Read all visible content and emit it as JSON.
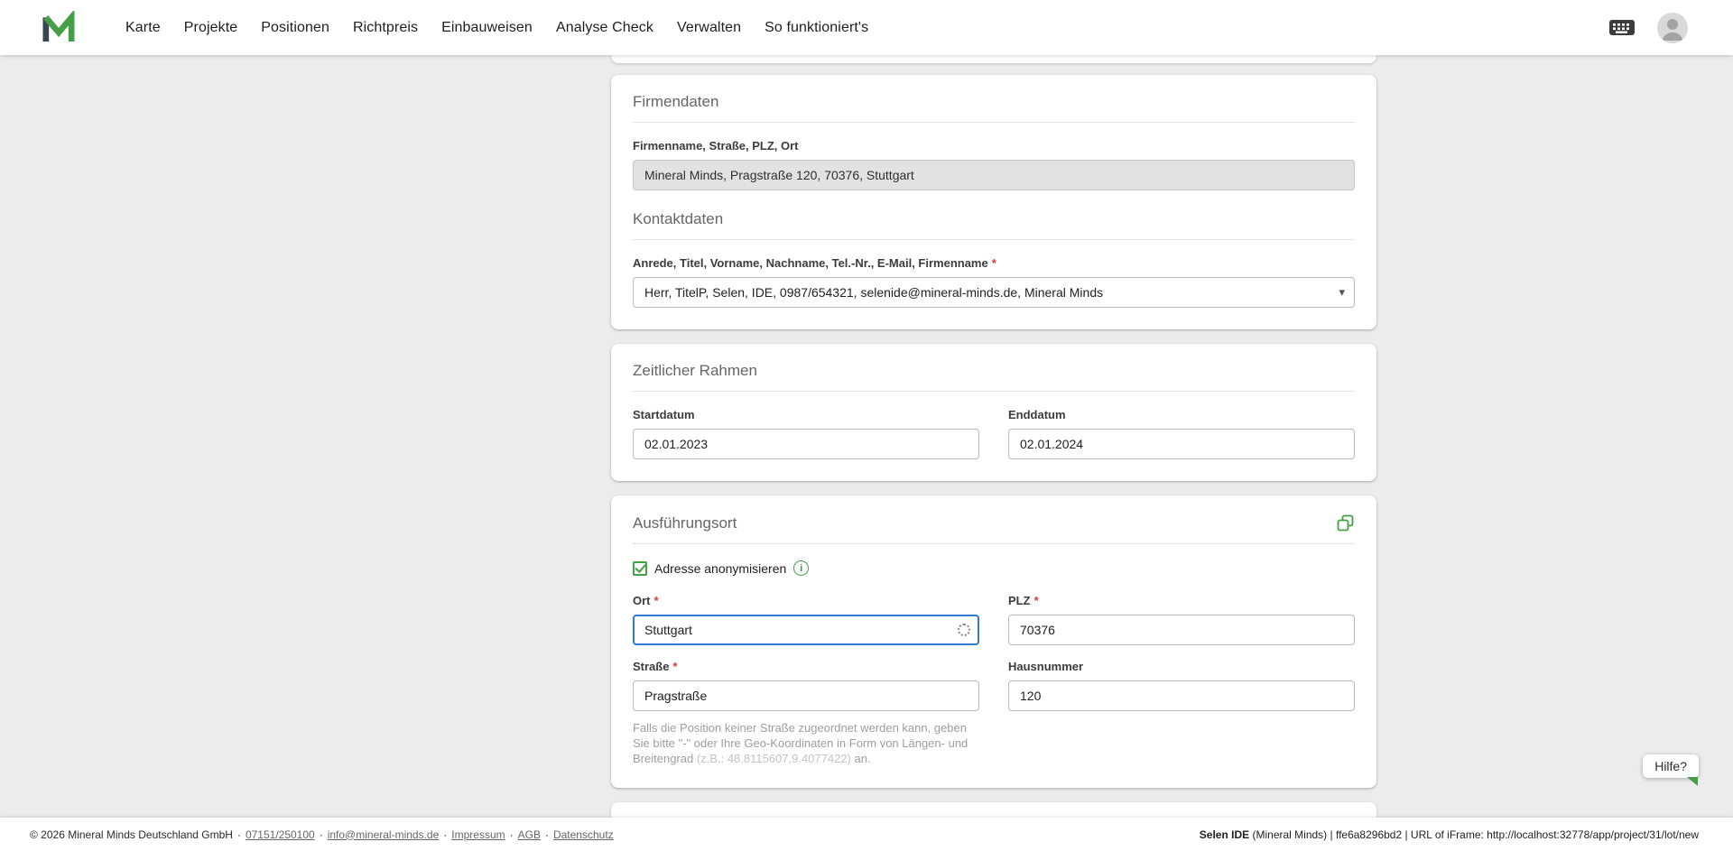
{
  "nav": {
    "items": [
      "Karte",
      "Projekte",
      "Positionen",
      "Richtpreis",
      "Einbauweisen",
      "Analyse Check",
      "Verwalten",
      "So funktioniert's"
    ]
  },
  "misc": {
    "required_marker": "*",
    "caret": "▾",
    "info_glyph": "i",
    "separator": "·"
  },
  "colors": {
    "brand_green": "#43a047",
    "focus_blue": "#2e7cd6",
    "required_red": "#e53935"
  },
  "cards": {
    "firmendaten": {
      "title": "Firmendaten",
      "company_label": "Firmenname, Straße, PLZ, Ort",
      "company_value": "Mineral Minds, Pragstraße 120, 70376, Stuttgart",
      "kontakt_title": "Kontaktdaten",
      "kontakt_label": "Anrede, Titel, Vorname, Nachname, Tel.-Nr., E-Mail, Firmenname",
      "kontakt_value": "Herr, TitelP, Selen, IDE, 0987/654321, selenide@mineral-minds.de, Mineral Minds"
    },
    "zeitraum": {
      "title": "Zeitlicher Rahmen",
      "start_label": "Startdatum",
      "start_value": "02.01.2023",
      "end_label": "Enddatum",
      "end_value": "02.01.2024"
    },
    "ausfuehrungsort": {
      "title": "Ausführungsort",
      "anonymize_label": "Adresse anonymisieren",
      "ort_label": "Ort",
      "ort_value": "Stuttgart",
      "plz_label": "PLZ",
      "plz_value": "70376",
      "strasse_label": "Straße",
      "strasse_value": "Pragstraße",
      "hausnummer_label": "Hausnummer",
      "hausnummer_value": "120",
      "helper_text": "Falls die Position keiner Straße zugeordnet werden kann, geben Sie bitte \"-\" oder Ihre Geo-Koordinaten in Form von Längen- und Breitengrad ",
      "helper_example": "(z.B.: 48.8115607,9.4077422)",
      "helper_suffix": " an."
    }
  },
  "help_button": {
    "label": "Hilfe?"
  },
  "footer": {
    "copyright": "© 2026 Mineral Minds Deutschland GmbH",
    "links": [
      "07151/250100",
      "info@mineral-minds.de",
      "Impressum",
      "AGB",
      "Datenschutz"
    ],
    "right_bold": "Selen IDE",
    "right_rest": " (Mineral Minds) | ffe6a8296bd2 | URL of iFrame: http://localhost:32778/app/project/31/lot/new"
  }
}
